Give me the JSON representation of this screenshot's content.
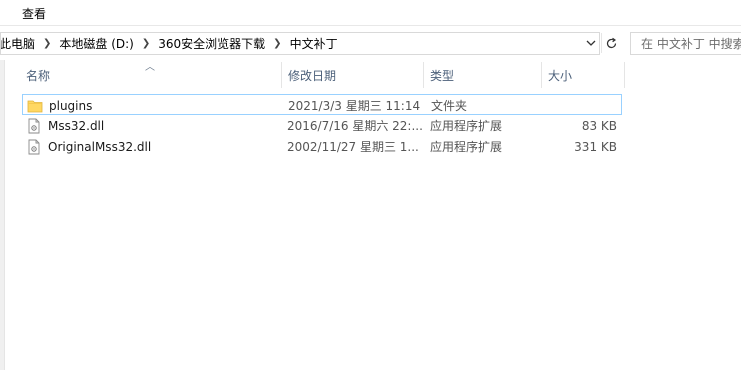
{
  "menubar": {
    "view_label": "查看"
  },
  "address": {
    "breadcrumbs": [
      "此电脑",
      "本地磁盘 (D:)",
      "360安全浏览器下载",
      "中文补丁"
    ]
  },
  "search": {
    "placeholder": "在 中文补丁 中搜索"
  },
  "columns": {
    "name": "名称",
    "date": "修改日期",
    "type": "类型",
    "size": "大小"
  },
  "files": [
    {
      "name": "plugins",
      "date": "2021/3/3 星期三 11:14",
      "type": "文件夹",
      "size": "",
      "icon": "folder-icon"
    },
    {
      "name": "Mss32.dll",
      "date": "2016/7/16 星期六 22:...",
      "type": "应用程序扩展",
      "size": "83 KB",
      "icon": "dll-file-icon"
    },
    {
      "name": "OriginalMss32.dll",
      "date": "2002/11/27 星期三 1...",
      "type": "应用程序扩展",
      "size": "331 KB",
      "icon": "dll-file-icon"
    }
  ],
  "colors": {
    "folder": "#ffd864",
    "header_text": "#4c607a",
    "hover_border": "#99d1ff"
  }
}
